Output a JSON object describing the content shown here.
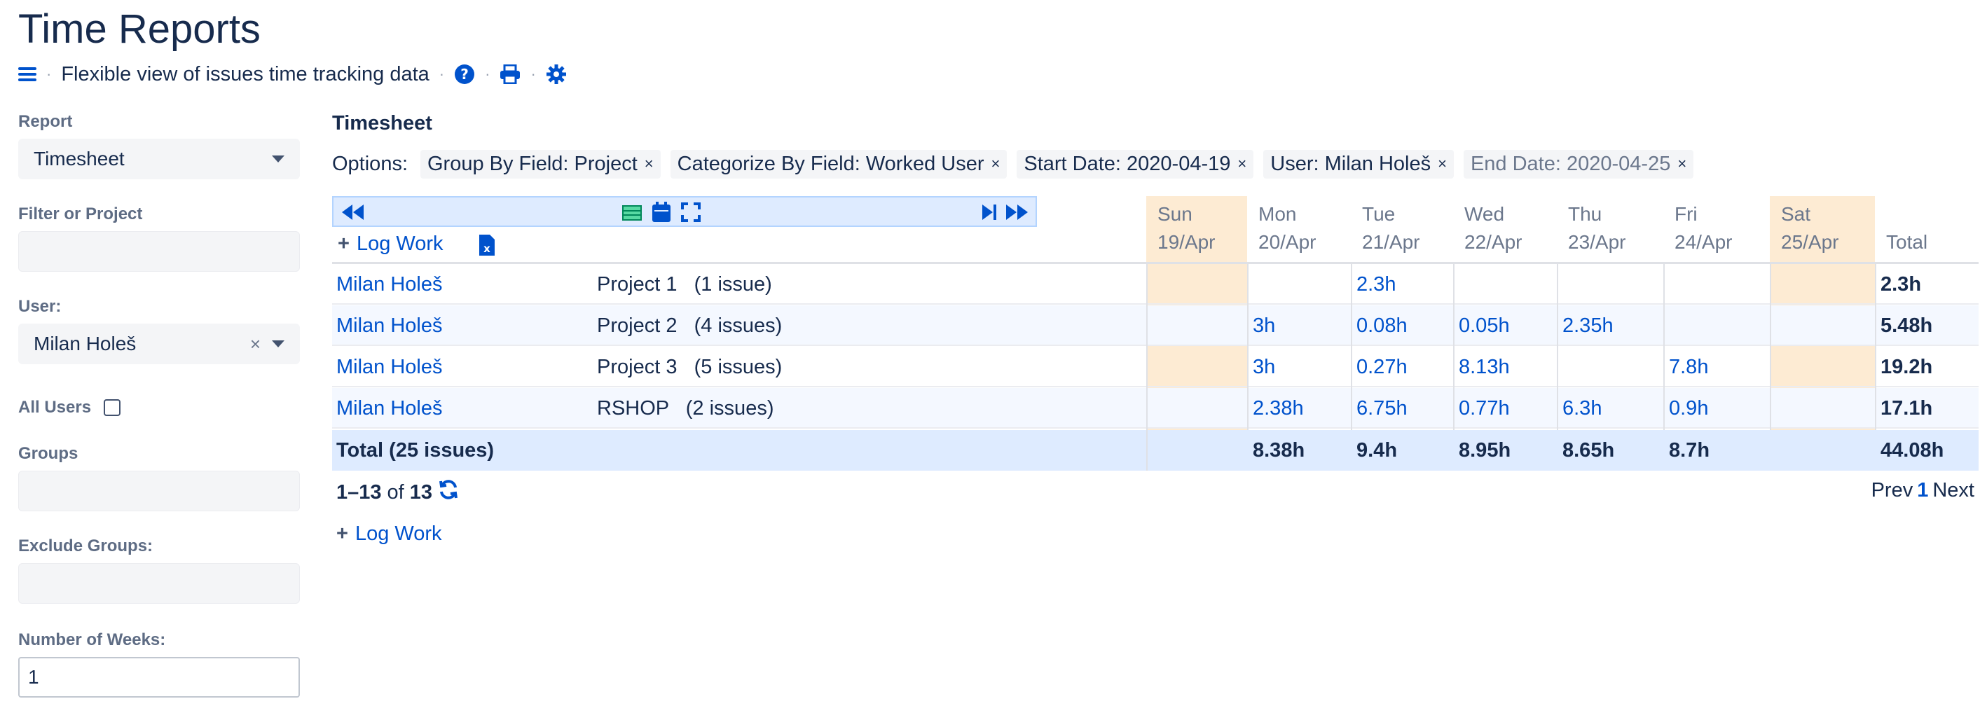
{
  "header": {
    "title": "Time Reports",
    "subtitle": "Flexible view of issues time tracking data"
  },
  "sidebar": {
    "report_label": "Report",
    "report_value": "Timesheet",
    "filter_label": "Filter or Project",
    "filter_value": "",
    "user_label": "User:",
    "user_value": "Milan Holeš",
    "clear_glyph": "×",
    "all_users_label": "All Users",
    "groups_label": "Groups",
    "exclude_groups_label": "Exclude Groups:",
    "weeks_label": "Number of Weeks:",
    "weeks_value": "1"
  },
  "main": {
    "section_title": "Timesheet",
    "options_label": "Options:",
    "chips": [
      {
        "text": "Group By Field: Project",
        "x": "×"
      },
      {
        "text": "Categorize By Field: Worked User",
        "x": "×"
      },
      {
        "text": "Start Date: 2020-04-19",
        "x": "×"
      },
      {
        "text": "User: Milan Holeš",
        "x": "×"
      },
      {
        "text": "End Date: 2020-04-25",
        "x": "×"
      }
    ]
  },
  "timesheet": {
    "log_work_label": "Log Work",
    "days": [
      {
        "day": "Sun",
        "date": "19/Apr"
      },
      {
        "day": "Mon",
        "date": "20/Apr"
      },
      {
        "day": "Tue",
        "date": "21/Apr"
      },
      {
        "day": "Wed",
        "date": "22/Apr"
      },
      {
        "day": "Thu",
        "date": "23/Apr"
      },
      {
        "day": "Fri",
        "date": "24/Apr"
      },
      {
        "day": "Sat",
        "date": "25/Apr"
      }
    ],
    "total_header": "Total",
    "rows": [
      {
        "user": "Milan Holeš",
        "project": "Project 1   (1 issue)",
        "cells": [
          "",
          "",
          "2.3h",
          "",
          "",
          "",
          ""
        ],
        "total": "2.3h"
      },
      {
        "user": "Milan Holeš",
        "project": "Project 2   (4 issues)",
        "cells": [
          "",
          "3h",
          "0.08h",
          "0.05h",
          "2.35h",
          "",
          ""
        ],
        "total": "5.48h"
      },
      {
        "user": "Milan Holeš",
        "project": "Project 3   (5 issues)",
        "cells": [
          "",
          "3h",
          "0.27h",
          "8.13h",
          "",
          "7.8h",
          ""
        ],
        "total": "19.2h"
      },
      {
        "user": "Milan Holeš",
        "project": "RSHOP   (2 issues)",
        "cells": [
          "",
          "2.38h",
          "6.75h",
          "0.77h",
          "6.3h",
          "0.9h",
          ""
        ],
        "total": "17.1h"
      }
    ],
    "totals_row": {
      "label": "Total (25 issues)",
      "cells": [
        "",
        "8.38h",
        "9.4h",
        "8.95h",
        "8.65h",
        "8.7h",
        ""
      ],
      "total": "44.08h"
    },
    "pager": {
      "range": "1–13",
      "of": "of",
      "count": "13",
      "prev": "Prev",
      "page": "1",
      "next": "Next"
    }
  },
  "colors": {
    "accent": "#0052cc",
    "weekend": "#fdebd3",
    "total_row": "#deebff"
  }
}
